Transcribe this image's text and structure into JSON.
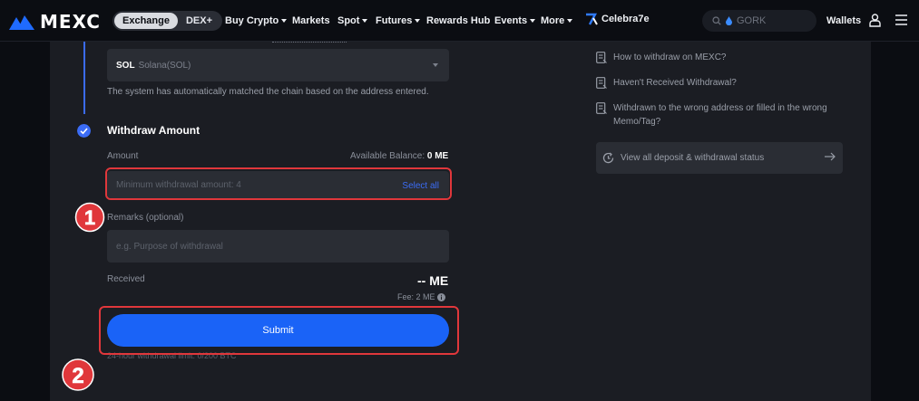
{
  "brand": {
    "name": "MEXC"
  },
  "topnav": {
    "toggle": [
      "Exchange",
      "DEX+"
    ],
    "items": [
      {
        "label": "Buy Crypto",
        "dropdown": true
      },
      {
        "label": "Markets",
        "dropdown": false
      },
      {
        "label": "Spot",
        "dropdown": true
      },
      {
        "label": "Futures",
        "dropdown": true
      },
      {
        "label": "Rewards Hub",
        "dropdown": false
      },
      {
        "label": "Events",
        "dropdown": true
      },
      {
        "label": "More",
        "dropdown": true
      },
      {
        "label": "Celebra7e",
        "dropdown": false
      }
    ],
    "search_value": "GORK",
    "wallets_label": "Wallets"
  },
  "withdraw": {
    "network": {
      "code": "SOL",
      "name": "Solana(SOL)"
    },
    "network_hint": "The system has automatically matched the chain based on the address entered.",
    "section_title": "Withdraw Amount",
    "amount_label": "Amount",
    "available_label": "Available Balance:",
    "available_value": "0 ME",
    "amount_placeholder": "Minimum withdrawal amount: 4",
    "select_all": "Select all",
    "remarks_label": "Remarks (optional)",
    "remarks_placeholder": "e.g. Purpose of withdrawal",
    "received_label": "Received",
    "received_value": "-- ME",
    "fee": "Fee: 2 ME",
    "submit_label": "Submit",
    "limit_text": "24-hour withdrawal limit: 0/200 BTC"
  },
  "annotations": {
    "badge_1": "1",
    "badge_2": "2",
    "badge_color": "#e0373b"
  },
  "help": {
    "faq": [
      "How to withdraw on MEXC?",
      "Haven't Received Withdrawal?",
      "Withdrawn to the wrong address or filled in the wrong Memo/Tag?"
    ],
    "status_link": "View all deposit & withdrawal status"
  },
  "colors": {
    "accent": "#1a63f7",
    "panel": "#1b1d23",
    "field": "#2a2d34",
    "highlight": "#e0373b"
  }
}
